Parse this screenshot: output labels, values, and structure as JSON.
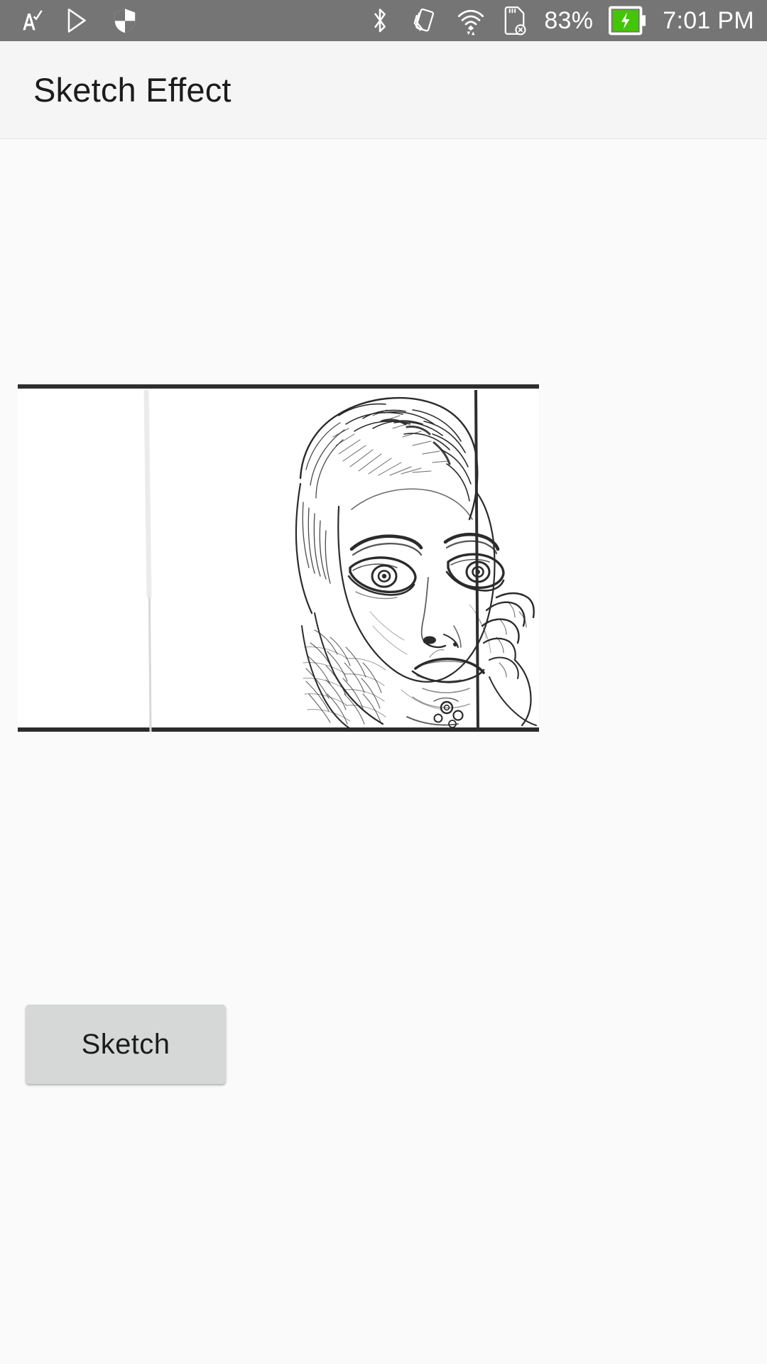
{
  "status_bar": {
    "background_color": "#757575",
    "foreground_color": "#ffffff",
    "left_icons": [
      {
        "name": "spellcheck-icon",
        "glyph": "A"
      },
      {
        "name": "google-play-icon",
        "glyph": "play"
      },
      {
        "name": "shield-icon",
        "glyph": "shield"
      }
    ],
    "right_icons": [
      {
        "name": "bluetooth-icon",
        "glyph": "bluetooth"
      },
      {
        "name": "screen-rotation-icon",
        "glyph": "rotation"
      },
      {
        "name": "wifi-icon",
        "glyph": "wifi"
      },
      {
        "name": "sd-card-removed-icon",
        "glyph": "sdcard-x"
      }
    ],
    "battery_percent": "83%",
    "battery_charging": true,
    "battery_fill_color": "#43c606",
    "clock": "7:01 PM"
  },
  "app_bar": {
    "title": "Sketch Effect",
    "background_color": "#f5f5f5",
    "title_color": "#1c1c1c"
  },
  "content": {
    "background_color": "#fafafa",
    "image_view": {
      "name": "sketch-preview-image",
      "description": "Pencil sketch effect portrait of a woman with hand raised near her face, white background with dark horizontal border line at top and bottom and a vertical line behind her head",
      "background_color": "#ffffff",
      "stroke_color": "#2b2b2b"
    },
    "sketch_button": {
      "label": "Sketch",
      "background_color": "#d6d7d7",
      "text_color": "#1c1c1c"
    }
  }
}
